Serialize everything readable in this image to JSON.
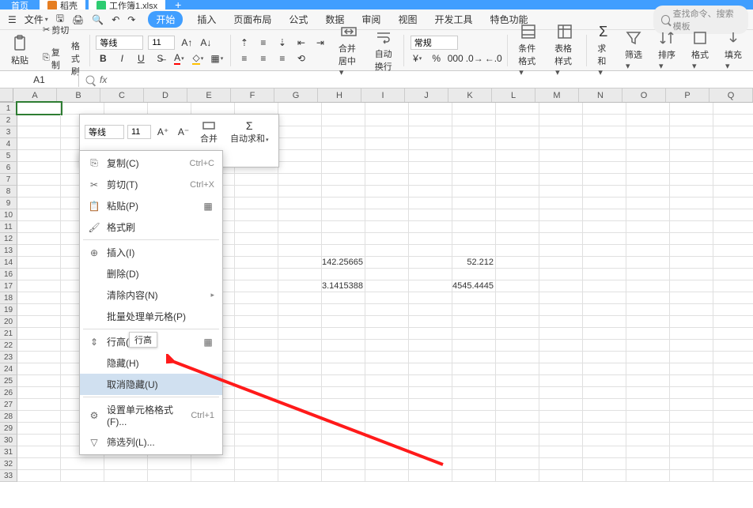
{
  "top_tabs": {
    "t1": "首页",
    "t2": "稻壳",
    "t3": "工作簿1.xlsx"
  },
  "menu": {
    "file": "文件",
    "items": [
      "开始",
      "插入",
      "页面布局",
      "公式",
      "数据",
      "审阅",
      "视图",
      "开发工具",
      "特色功能"
    ],
    "search_ph": "查找命令、搜索模板"
  },
  "ribbon": {
    "paste": "粘贴",
    "cut": "剪切",
    "copy": "复制",
    "brush": "格式刷",
    "font_name": "等线",
    "font_size": "11",
    "merge": "合并居中",
    "wrap": "自动换行",
    "general": "常规",
    "cond_fmt": "条件格式",
    "tbl_style": "表格样式",
    "sum": "求和",
    "filter": "筛选",
    "sort": "排序",
    "format": "格式",
    "fill": "填充"
  },
  "name_box": "A1",
  "fx_label": "fx",
  "columns": [
    "A",
    "B",
    "C",
    "D",
    "E",
    "F",
    "G",
    "H",
    "I",
    "J",
    "K",
    "L",
    "M",
    "N",
    "O",
    "P",
    "Q"
  ],
  "rows": [
    1,
    2,
    3,
    4,
    5,
    6,
    7,
    8,
    9,
    10,
    11,
    12,
    13,
    14,
    16,
    17,
    18,
    19,
    20,
    21,
    22,
    23,
    24,
    25,
    26,
    27,
    28,
    29,
    30,
    31,
    32,
    33
  ],
  "cells": {
    "H14": "142.25665",
    "K14": "52.212",
    "H17": "3.1415388",
    "K17": "4545.4445"
  },
  "mini": {
    "font_name": "等线",
    "font_size": "11",
    "merge": "合并",
    "sum": "自动求和"
  },
  "ctx": {
    "copy": "复制(C)",
    "copy_sc": "Ctrl+C",
    "cut": "剪切(T)",
    "cut_sc": "Ctrl+X",
    "paste": "粘贴(P)",
    "brush": "格式刷",
    "insert": "插入(I)",
    "delete": "删除(D)",
    "clear": "清除内容(N)",
    "batch": "批量处理单元格(P)",
    "rowh": "行高(R",
    "rowh_tip": "行高",
    "hide": "隐藏(H)",
    "unhide": "取消隐藏(U)",
    "format": "设置单元格格式(F)...",
    "format_sc": "Ctrl+1",
    "filter": "筛选列(L)..."
  }
}
